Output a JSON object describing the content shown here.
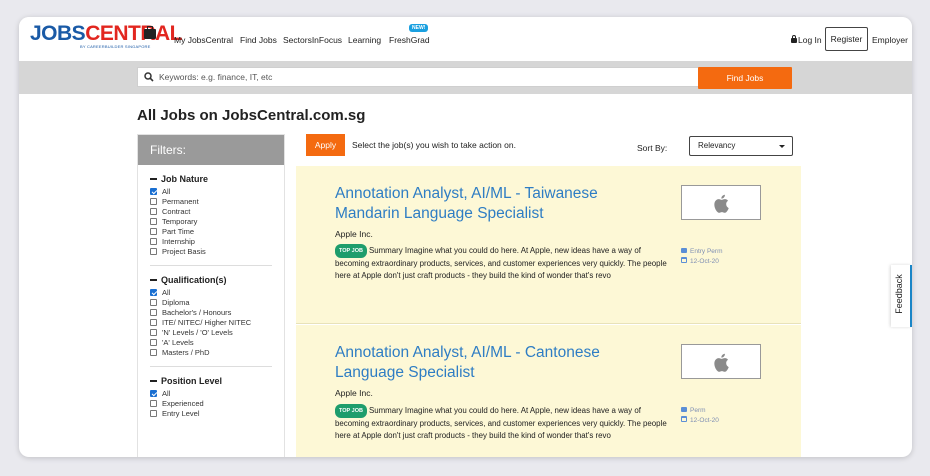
{
  "header": {
    "logo_main": "JOBSCENTRAL",
    "logo_sub": "BY CAREERBUILDER SINGAPORE",
    "nav": [
      "My JobsCentral",
      "Find Jobs",
      "SectorsInFocus",
      "Learning",
      "FreshGrad"
    ],
    "new_badge": "NEW!",
    "login": "Log In",
    "register": "Register",
    "employer": "Employer"
  },
  "search": {
    "placeholder": "Keywords: e.g. finance, IT, etc",
    "button": "Find Jobs"
  },
  "page_title": "All Jobs on JobsCentral.com.sg",
  "filters": {
    "title": "Filters:",
    "groups": [
      {
        "title": "Job Nature",
        "options": [
          {
            "label": "All",
            "checked": true
          },
          {
            "label": "Permanent",
            "checked": false
          },
          {
            "label": "Contract",
            "checked": false
          },
          {
            "label": "Temporary",
            "checked": false
          },
          {
            "label": "Part Time",
            "checked": false
          },
          {
            "label": "Internship",
            "checked": false
          },
          {
            "label": "Project Basis",
            "checked": false
          }
        ]
      },
      {
        "title": "Qualification(s)",
        "options": [
          {
            "label": "All",
            "checked": true
          },
          {
            "label": "Diploma",
            "checked": false
          },
          {
            "label": "Bachelor's / Honours",
            "checked": false
          },
          {
            "label": "ITE/ NITEC/ Higher NITEC",
            "checked": false
          },
          {
            "label": "'N' Levels / 'O' Levels",
            "checked": false
          },
          {
            "label": "'A' Levels",
            "checked": false
          },
          {
            "label": "Masters / PhD",
            "checked": false
          }
        ]
      },
      {
        "title": "Position Level",
        "options": [
          {
            "label": "All",
            "checked": true
          },
          {
            "label": "Experienced",
            "checked": false
          },
          {
            "label": "Entry Level",
            "checked": false
          }
        ]
      }
    ]
  },
  "actions": {
    "apply": "Apply",
    "instruction": "Select the job(s) you wish to take action on.",
    "sort_label": "Sort By:",
    "sort_value": "Relevancy"
  },
  "jobs": [
    {
      "title": "Annotation Analyst, AI/ML - Taiwanese Mandarin Language Specialist",
      "company": "Apple Inc.",
      "badge": "TOP JOB",
      "description": "Summary Imagine what you could do here. At Apple, new ideas have a way of becoming extraordinary products, services, and customer experiences very quickly. The people here at Apple don't just craft products - they build the kind of wonder that's revo",
      "level": "Entry Perm",
      "date": "12-Oct-20"
    },
    {
      "title": "Annotation Analyst, AI/ML - Cantonese Language Specialist",
      "company": "Apple Inc.",
      "badge": "TOP JOB",
      "description": "Summary Imagine what you could do here. At Apple, new ideas have a way of becoming extraordinary products, services, and customer experiences very quickly. The people here at Apple don't just craft products - they build the kind of wonder that's revo",
      "level": "Perm",
      "date": "12-Oct-20"
    }
  ],
  "feedback": "Feedback",
  "colors": {
    "brand_blue": "#1a5aa6",
    "brand_red": "#e2261f",
    "accent_orange": "#f46a10",
    "job_title_blue": "#2e7dc4",
    "job_card_bg": "#fdf8d6"
  }
}
